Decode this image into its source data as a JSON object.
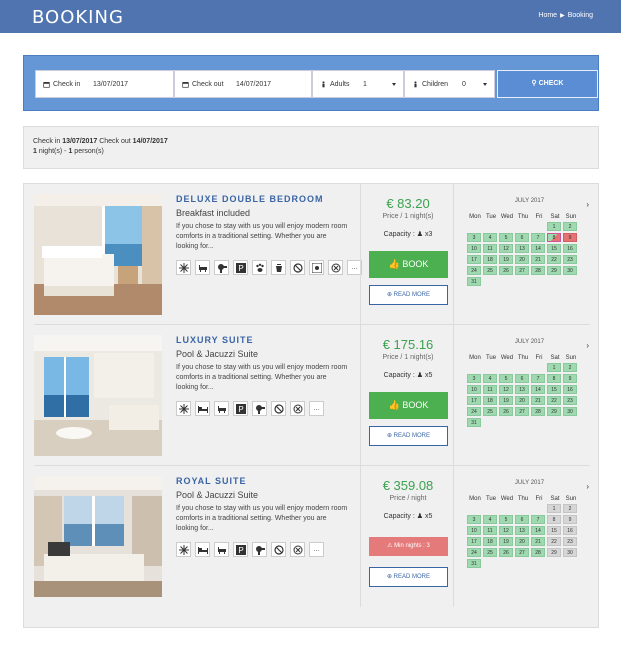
{
  "header": {
    "title": "BOOKING",
    "crumb_home": "Home",
    "crumb_current": "Booking"
  },
  "search": {
    "checkin_label": "Check in",
    "checkin_value": "13/07/2017",
    "checkout_label": "Check out",
    "checkout_value": "14/07/2017",
    "adults_label": "Adults",
    "adults_value": "1",
    "children_label": "Children",
    "children_value": "0",
    "check_button": "CHECK"
  },
  "summary": {
    "checkin_prefix": "Check in",
    "checkin_date": "13/07/2017",
    "checkout_prefix": "Check out",
    "checkout_date": "14/07/2017",
    "nights": "1",
    "nights_text": "night(s) -",
    "persons": "1",
    "persons_text": "person(s)"
  },
  "rooms": [
    {
      "name": "DELUXE DOUBLE BEDROOM",
      "subtitle": "Breakfast included",
      "description": "If you chose to stay with us you will enjoy modern room comforts in a traditional setting. Whether you are looking for...",
      "price": "€ 83.20",
      "price_per": "Price / 1 night(s)",
      "capacity_label": "Capacity :",
      "capacity_value": "x3",
      "action": "BOOK",
      "read_more": "READ MORE",
      "amenities": [
        "snowflake-icon",
        "bathtub-icon",
        "hairdryer-icon",
        "parking-icon",
        "pet-icon",
        "kettle-icon",
        "no-smoking-icon",
        "wifi-icon",
        "safe-icon",
        "more-icon"
      ],
      "calendar": {
        "month": "JULY 2017",
        "days": [
          "Mon",
          "Tue",
          "Wed",
          "Thu",
          "Fri",
          "Sat",
          "Sun"
        ]
      }
    },
    {
      "name": "LUXURY SUITE",
      "subtitle": "Pool & Jacuzzi Suite",
      "description": "If you chose to stay with us you will enjoy modern room comforts in a traditional setting. Whether you are looking for...",
      "price": "€ 175.16",
      "price_per": "Price / 1 night(s)",
      "capacity_label": "Capacity :",
      "capacity_value": "x5",
      "action": "BOOK",
      "read_more": "READ MORE",
      "amenities": [
        "snowflake-icon",
        "bed-icon",
        "bathtub-icon",
        "parking-icon",
        "hairdryer-icon",
        "no-smoking-icon",
        "safe-icon",
        "more-icon"
      ],
      "calendar": {
        "month": "JULY 2017",
        "days": [
          "Mon",
          "Tue",
          "Wed",
          "Thu",
          "Fri",
          "Sat",
          "Sun"
        ]
      }
    },
    {
      "name": "ROYAL SUITE",
      "subtitle": "Pool & Jacuzzi Suite",
      "description": "If you chose to stay with us you will enjoy modern room comforts in a traditional setting. Whether you are looking for...",
      "price": "€ 359.08",
      "price_per": "Price / night",
      "capacity_label": "Capacity :",
      "capacity_value": "x5",
      "action": "Min nights : 3",
      "read_more": "READ MORE",
      "amenities": [
        "snowflake-icon",
        "bed-icon",
        "bathtub-icon",
        "parking-icon",
        "hairdryer-icon",
        "no-smoking-icon",
        "safe-icon",
        "more-icon"
      ],
      "calendar": {
        "month": "JULY 2017",
        "days": [
          "Mon",
          "Tue",
          "Wed",
          "Thu",
          "Fri",
          "Sat",
          "Sun"
        ]
      }
    }
  ]
}
